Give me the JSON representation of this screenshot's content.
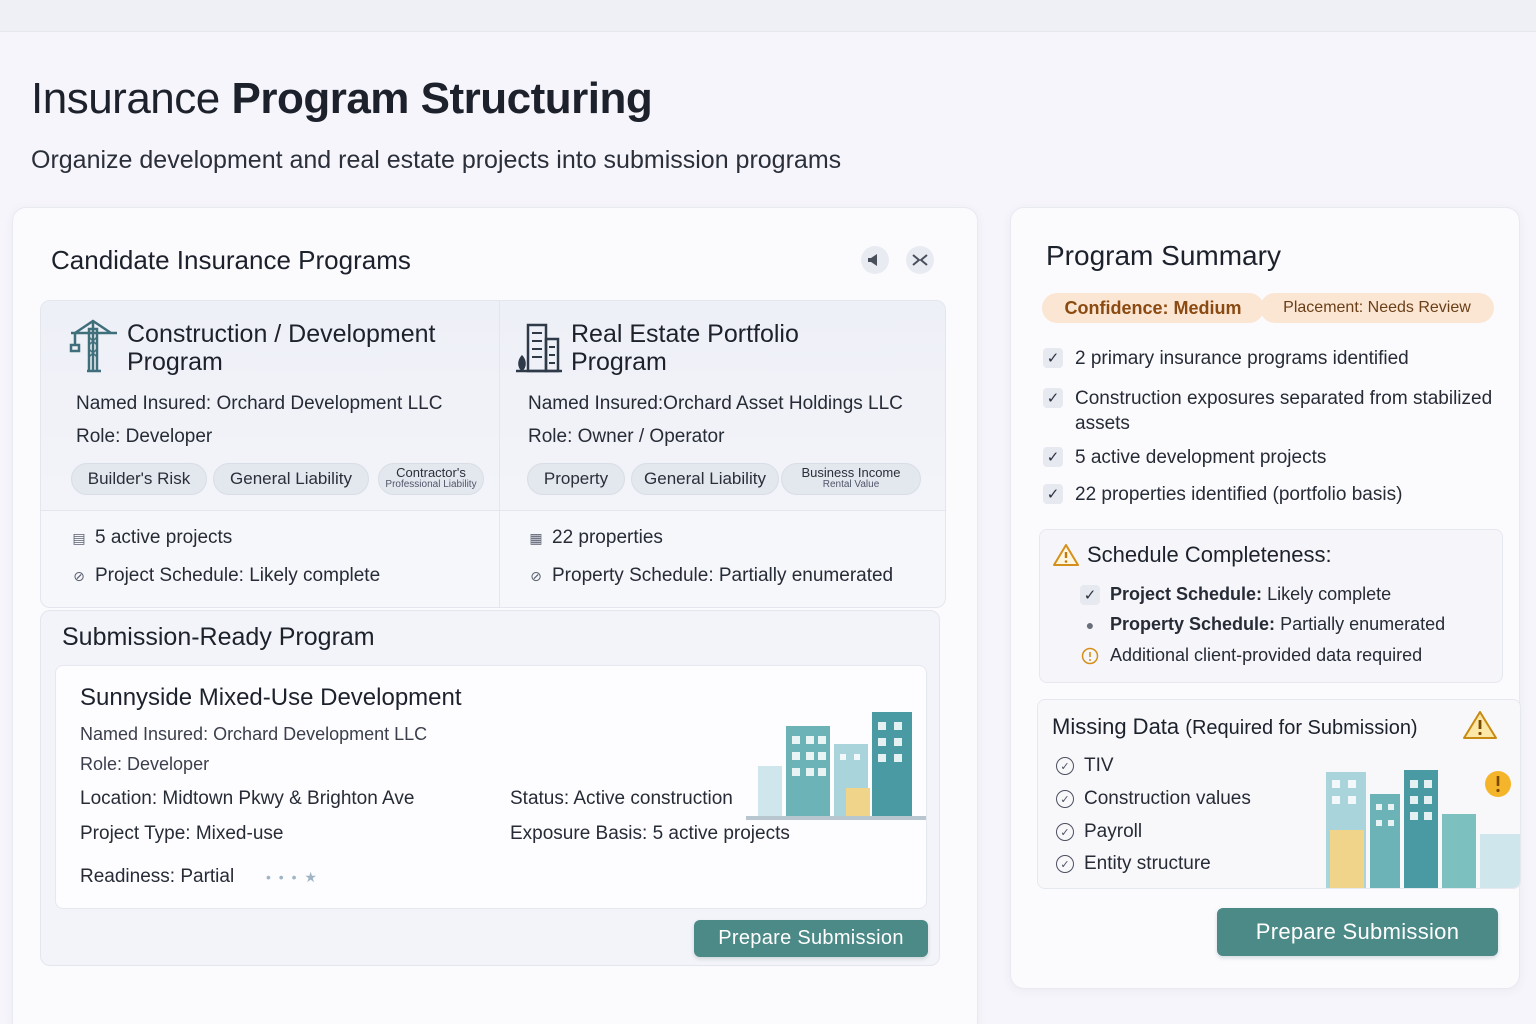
{
  "header": {
    "title_light": "Insurance",
    "title_bold": "Program Structuring",
    "subtitle": "Organize development and real estate projects into submission programs"
  },
  "candidates": {
    "section_title": "Candidate Insurance Programs",
    "programs": [
      {
        "title_line1": "Construction / Development",
        "title_line2": "Program",
        "icon": "crane-icon",
        "named_insured": "Named Insured: Orchard Development LLC",
        "role": "Role: Developer",
        "tags": [
          "Builder's Risk",
          "General Liability"
        ],
        "tag_small_line1": "Contractor's",
        "tag_small_line2": "Professional Liability",
        "count": "5 active projects",
        "schedule": "Project Schedule: Likely complete"
      },
      {
        "title_line1": "Real Estate Portfolio",
        "title_line2": "Program",
        "icon": "buildings-icon",
        "named_insured": "Named Insured:Orchard Asset Holdings LLC",
        "role": "Role: Owner / Operator",
        "tags": [
          "Property",
          "General Liability"
        ],
        "tag_small_line1": "Business Income",
        "tag_small_line2": "Rental Value",
        "count": "22 properties",
        "schedule": "Property Schedule: Partially enumerated"
      }
    ]
  },
  "submission": {
    "section_title": "Submission-Ready Program",
    "project_name": "Sunnyside Mixed-Use Development",
    "named_insured": "Named Insured: Orchard Development LLC",
    "role": "Role: Developer",
    "location": "Location: Midtown Pkwy & Brighton Ave",
    "project_type": "Project Type: Mixed-use",
    "status": "Status: Active construction",
    "exposure_basis": "Exposure Basis: 5 active projects",
    "readiness": "Readiness: Partial",
    "button": "Prepare Submission"
  },
  "summary": {
    "title": "Program Summary",
    "confidence": "Confidence: Medium",
    "placement": "Placement: Needs Review",
    "checks": [
      "2 primary insurance programs identified",
      "Construction exposures separated from stabilized assets",
      "5 active development projects",
      "22 properties identified (portfolio basis)"
    ],
    "schedule_title": "Schedule Completeness:",
    "schedule_rows": [
      {
        "label": "Project Schedule:",
        "value": "Likely complete"
      },
      {
        "label": "Property Schedule:",
        "value": "Partially enumerated"
      },
      {
        "label": "",
        "value": "Additional client-provided data required"
      }
    ],
    "missing_title": "Missing Data",
    "missing_qualifier": "(Required for Submission)",
    "missing_items": [
      "TIV",
      "Construction values",
      "Payroll",
      "Entity structure"
    ],
    "button": "Prepare Submission"
  },
  "colors": {
    "accent": "#4c8a87",
    "warning": "#e0a31e",
    "pill_bg": "#fbe6d3"
  }
}
